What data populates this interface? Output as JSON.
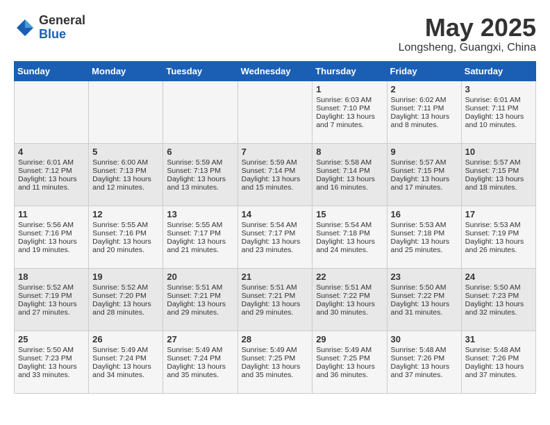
{
  "logo": {
    "general": "General",
    "blue": "Blue"
  },
  "header": {
    "month": "May 2025",
    "location": "Longsheng, Guangxi, China"
  },
  "weekdays": [
    "Sunday",
    "Monday",
    "Tuesday",
    "Wednesday",
    "Thursday",
    "Friday",
    "Saturday"
  ],
  "weeks": [
    [
      {
        "day": "",
        "sunrise": "",
        "sunset": "",
        "daylight": ""
      },
      {
        "day": "",
        "sunrise": "",
        "sunset": "",
        "daylight": ""
      },
      {
        "day": "",
        "sunrise": "",
        "sunset": "",
        "daylight": ""
      },
      {
        "day": "",
        "sunrise": "",
        "sunset": "",
        "daylight": ""
      },
      {
        "day": "1",
        "sunrise": "Sunrise: 6:03 AM",
        "sunset": "Sunset: 7:10 PM",
        "daylight": "Daylight: 13 hours and 7 minutes."
      },
      {
        "day": "2",
        "sunrise": "Sunrise: 6:02 AM",
        "sunset": "Sunset: 7:11 PM",
        "daylight": "Daylight: 13 hours and 8 minutes."
      },
      {
        "day": "3",
        "sunrise": "Sunrise: 6:01 AM",
        "sunset": "Sunset: 7:11 PM",
        "daylight": "Daylight: 13 hours and 10 minutes."
      }
    ],
    [
      {
        "day": "4",
        "sunrise": "Sunrise: 6:01 AM",
        "sunset": "Sunset: 7:12 PM",
        "daylight": "Daylight: 13 hours and 11 minutes."
      },
      {
        "day": "5",
        "sunrise": "Sunrise: 6:00 AM",
        "sunset": "Sunset: 7:13 PM",
        "daylight": "Daylight: 13 hours and 12 minutes."
      },
      {
        "day": "6",
        "sunrise": "Sunrise: 5:59 AM",
        "sunset": "Sunset: 7:13 PM",
        "daylight": "Daylight: 13 hours and 13 minutes."
      },
      {
        "day": "7",
        "sunrise": "Sunrise: 5:59 AM",
        "sunset": "Sunset: 7:14 PM",
        "daylight": "Daylight: 13 hours and 15 minutes."
      },
      {
        "day": "8",
        "sunrise": "Sunrise: 5:58 AM",
        "sunset": "Sunset: 7:14 PM",
        "daylight": "Daylight: 13 hours and 16 minutes."
      },
      {
        "day": "9",
        "sunrise": "Sunrise: 5:57 AM",
        "sunset": "Sunset: 7:15 PM",
        "daylight": "Daylight: 13 hours and 17 minutes."
      },
      {
        "day": "10",
        "sunrise": "Sunrise: 5:57 AM",
        "sunset": "Sunset: 7:15 PM",
        "daylight": "Daylight: 13 hours and 18 minutes."
      }
    ],
    [
      {
        "day": "11",
        "sunrise": "Sunrise: 5:56 AM",
        "sunset": "Sunset: 7:16 PM",
        "daylight": "Daylight: 13 hours and 19 minutes."
      },
      {
        "day": "12",
        "sunrise": "Sunrise: 5:55 AM",
        "sunset": "Sunset: 7:16 PM",
        "daylight": "Daylight: 13 hours and 20 minutes."
      },
      {
        "day": "13",
        "sunrise": "Sunrise: 5:55 AM",
        "sunset": "Sunset: 7:17 PM",
        "daylight": "Daylight: 13 hours and 21 minutes."
      },
      {
        "day": "14",
        "sunrise": "Sunrise: 5:54 AM",
        "sunset": "Sunset: 7:17 PM",
        "daylight": "Daylight: 13 hours and 23 minutes."
      },
      {
        "day": "15",
        "sunrise": "Sunrise: 5:54 AM",
        "sunset": "Sunset: 7:18 PM",
        "daylight": "Daylight: 13 hours and 24 minutes."
      },
      {
        "day": "16",
        "sunrise": "Sunrise: 5:53 AM",
        "sunset": "Sunset: 7:18 PM",
        "daylight": "Daylight: 13 hours and 25 minutes."
      },
      {
        "day": "17",
        "sunrise": "Sunrise: 5:53 AM",
        "sunset": "Sunset: 7:19 PM",
        "daylight": "Daylight: 13 hours and 26 minutes."
      }
    ],
    [
      {
        "day": "18",
        "sunrise": "Sunrise: 5:52 AM",
        "sunset": "Sunset: 7:19 PM",
        "daylight": "Daylight: 13 hours and 27 minutes."
      },
      {
        "day": "19",
        "sunrise": "Sunrise: 5:52 AM",
        "sunset": "Sunset: 7:20 PM",
        "daylight": "Daylight: 13 hours and 28 minutes."
      },
      {
        "day": "20",
        "sunrise": "Sunrise: 5:51 AM",
        "sunset": "Sunset: 7:21 PM",
        "daylight": "Daylight: 13 hours and 29 minutes."
      },
      {
        "day": "21",
        "sunrise": "Sunrise: 5:51 AM",
        "sunset": "Sunset: 7:21 PM",
        "daylight": "Daylight: 13 hours and 29 minutes."
      },
      {
        "day": "22",
        "sunrise": "Sunrise: 5:51 AM",
        "sunset": "Sunset: 7:22 PM",
        "daylight": "Daylight: 13 hours and 30 minutes."
      },
      {
        "day": "23",
        "sunrise": "Sunrise: 5:50 AM",
        "sunset": "Sunset: 7:22 PM",
        "daylight": "Daylight: 13 hours and 31 minutes."
      },
      {
        "day": "24",
        "sunrise": "Sunrise: 5:50 AM",
        "sunset": "Sunset: 7:23 PM",
        "daylight": "Daylight: 13 hours and 32 minutes."
      }
    ],
    [
      {
        "day": "25",
        "sunrise": "Sunrise: 5:50 AM",
        "sunset": "Sunset: 7:23 PM",
        "daylight": "Daylight: 13 hours and 33 minutes."
      },
      {
        "day": "26",
        "sunrise": "Sunrise: 5:49 AM",
        "sunset": "Sunset: 7:24 PM",
        "daylight": "Daylight: 13 hours and 34 minutes."
      },
      {
        "day": "27",
        "sunrise": "Sunrise: 5:49 AM",
        "sunset": "Sunset: 7:24 PM",
        "daylight": "Daylight: 13 hours and 35 minutes."
      },
      {
        "day": "28",
        "sunrise": "Sunrise: 5:49 AM",
        "sunset": "Sunset: 7:25 PM",
        "daylight": "Daylight: 13 hours and 35 minutes."
      },
      {
        "day": "29",
        "sunrise": "Sunrise: 5:49 AM",
        "sunset": "Sunset: 7:25 PM",
        "daylight": "Daylight: 13 hours and 36 minutes."
      },
      {
        "day": "30",
        "sunrise": "Sunrise: 5:48 AM",
        "sunset": "Sunset: 7:26 PM",
        "daylight": "Daylight: 13 hours and 37 minutes."
      },
      {
        "day": "31",
        "sunrise": "Sunrise: 5:48 AM",
        "sunset": "Sunset: 7:26 PM",
        "daylight": "Daylight: 13 hours and 37 minutes."
      }
    ]
  ]
}
